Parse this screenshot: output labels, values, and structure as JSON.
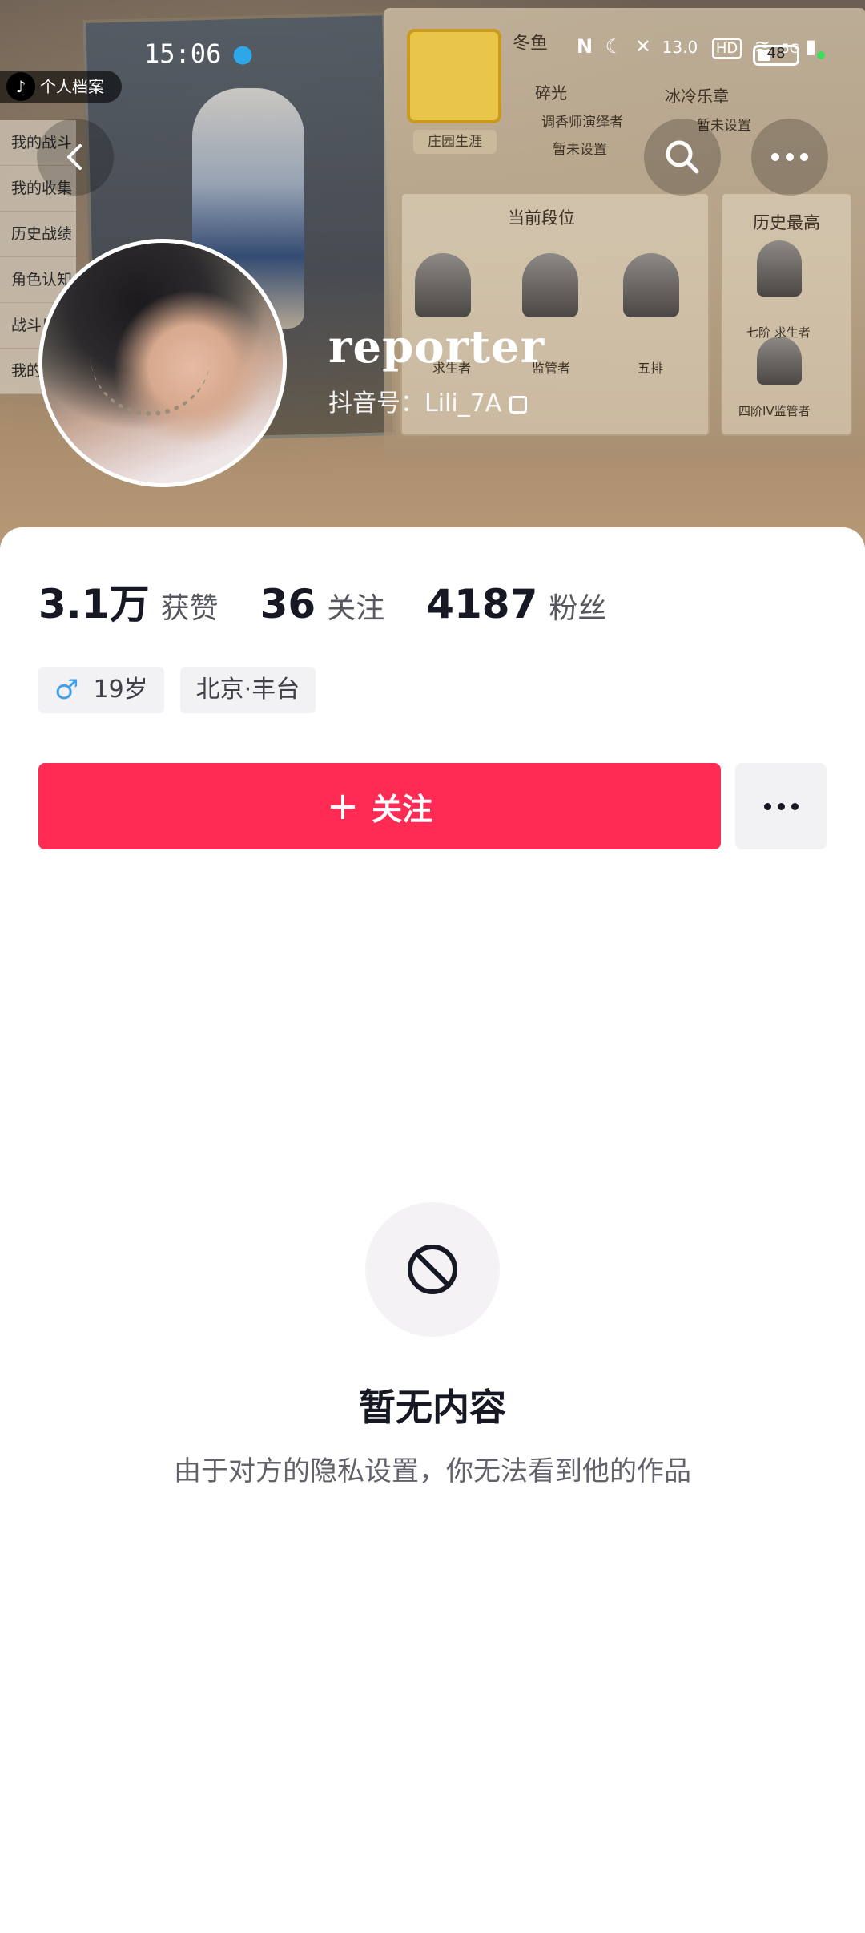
{
  "status_bar": {
    "time": "15:06",
    "network_speed": "13.0",
    "battery_level": "48",
    "network_type": "5G",
    "hd_label": "HD"
  },
  "banner": {
    "archive_tag": "个人档案",
    "side_menu": [
      "我的战斗",
      "我的收集",
      "历史战绩",
      "角色认知",
      "战斗日",
      "我的"
    ],
    "game_card_label": "庄园生涯",
    "game_player_name": "冬鱼",
    "game_badges": [
      "碎光",
      "冰冷乐章",
      "调香师演绎者",
      "暂未设置",
      "暂未设置"
    ],
    "current_rank_title": "当前段位",
    "history_high_title": "历史最高",
    "rank_labels": [
      "求生者",
      "监管者",
      "五排"
    ],
    "history_labels": [
      "七阶 求生者",
      "四阶IV监管者"
    ]
  },
  "profile": {
    "name": "reporter",
    "douyin_id_label": "抖音号：",
    "douyin_id": "Lili_7A"
  },
  "stats": [
    {
      "value": "3.1万",
      "label": "获赞"
    },
    {
      "value": "36",
      "label": "关注"
    },
    {
      "value": "4187",
      "label": "粉丝"
    }
  ],
  "tags": {
    "age": "19岁",
    "location": "北京·丰台"
  },
  "actions": {
    "follow_label": "关注"
  },
  "empty_state": {
    "title": "暂无内容",
    "description": "由于对方的隐私设置，你无法看到他的作品"
  },
  "colors": {
    "accent": "#fe2c55",
    "gender_icon": "#3e9fe8",
    "text_primary": "#161823",
    "text_secondary": "#57585f"
  }
}
